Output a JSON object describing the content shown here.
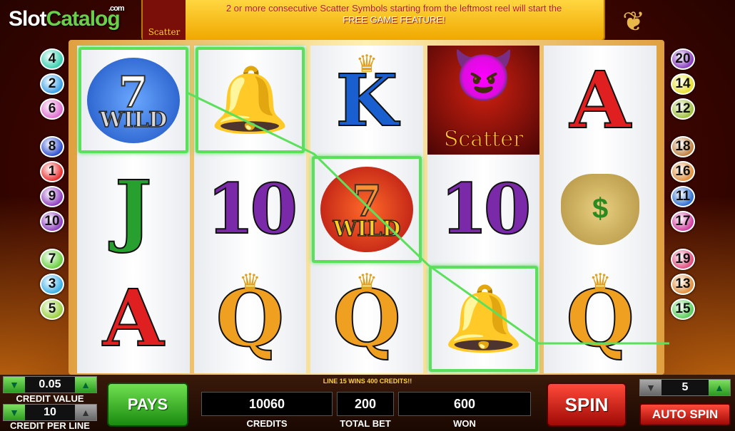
{
  "logo": {
    "main": "Slot",
    "accent": "Catalog",
    "suffix": ".com"
  },
  "banner": {
    "scatter_label": "Scatter",
    "line1": "2 or more consecutive Scatter Symbols starting from the leftmost reel will start the",
    "line2": "FREE GAME FEATURE!"
  },
  "left_lines": [
    "4",
    "2",
    "6",
    "8",
    "1",
    "9",
    "10",
    "7",
    "3",
    "5"
  ],
  "right_lines": [
    "20",
    "14",
    "12",
    "18",
    "16",
    "11",
    "17",
    "19",
    "13",
    "15"
  ],
  "line_colors": {
    "1": "#e83030",
    "2": "#3aa0e8",
    "3": "#3ab0e8",
    "4": "#3ad0b0",
    "5": "#9ad040",
    "6": "#e070d0",
    "7": "#6ad040",
    "8": "#3050d0",
    "9": "#9040c0",
    "10": "#9040c0",
    "11": "#3070d0",
    "12": "#a0c040",
    "13": "#e09040",
    "14": "#e8e030",
    "15": "#5ad05a",
    "16": "#e09040",
    "17": "#d040a0",
    "18": "#c08040",
    "19": "#e05080",
    "20": "#8a40c0"
  },
  "reels": [
    [
      {
        "type": "wild",
        "variant": "blue",
        "seven": "7",
        "text": "WILD"
      },
      {
        "type": "letter",
        "letter": "J",
        "cls": "j"
      },
      {
        "type": "letter",
        "letter": "A",
        "cls": "a"
      }
    ],
    [
      {
        "type": "bell"
      },
      {
        "type": "letter",
        "letter": "10",
        "cls": "ten"
      },
      {
        "type": "letter",
        "letter": "Q",
        "cls": "q",
        "crown": true
      }
    ],
    [
      {
        "type": "letter",
        "letter": "K",
        "cls": "k",
        "crown": true
      },
      {
        "type": "wild",
        "variant": "red",
        "seven": "7",
        "text": "WILD"
      },
      {
        "type": "letter",
        "letter": "Q",
        "cls": "q",
        "crown": true
      }
    ],
    [
      {
        "type": "scatter",
        "text": "Scatter"
      },
      {
        "type": "letter",
        "letter": "10",
        "cls": "ten"
      },
      {
        "type": "bell"
      }
    ],
    [
      {
        "type": "letter",
        "letter": "A",
        "cls": "a"
      },
      {
        "type": "moneybag",
        "text": "$"
      },
      {
        "type": "letter",
        "letter": "Q",
        "cls": "q",
        "crown": true
      }
    ]
  ],
  "win_cells": [
    [
      0,
      0
    ],
    [
      1,
      0
    ],
    [
      2,
      1
    ],
    [
      3,
      2
    ]
  ],
  "controls": {
    "credit_value": "0.05",
    "credit_value_label": "CREDIT VALUE",
    "credit_per_line": "10",
    "credit_per_line_label": "CREDIT PER LINE",
    "pays": "PAYS",
    "message": "LINE 15 WINS 400 CREDITS!!",
    "credits": "10060",
    "credits_label": "CREDITS",
    "total_bet": "200",
    "total_bet_label": "TOTAL BET",
    "won": "600",
    "won_label": "WON",
    "spin": "SPIN",
    "lines": "5",
    "auto_spin": "AUTO SPIN"
  }
}
